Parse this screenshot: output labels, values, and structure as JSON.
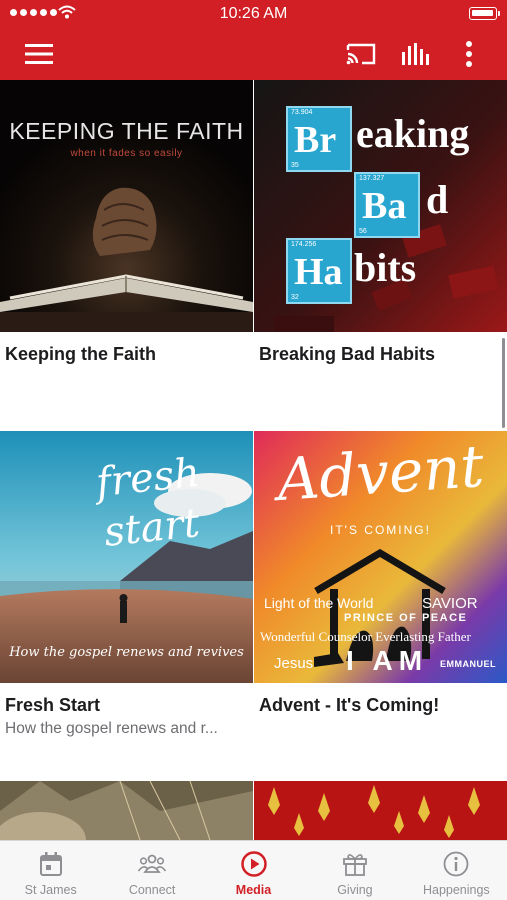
{
  "status_bar": {
    "time": "10:26 AM"
  },
  "nav": {
    "menu_icon": "hamburger-menu-icon",
    "cast_icon": "cast-icon",
    "audio_icon": "audio-bars-icon",
    "more_icon": "vertical-ellipsis-icon"
  },
  "series": [
    {
      "title": "Keeping the Faith",
      "subtitle": "",
      "art": {
        "headline": "KEEPING THE FAITH",
        "tagline": "when it fades so easily"
      }
    },
    {
      "title": "Breaking Bad Habits",
      "subtitle": "",
      "art": {
        "el1": {
          "num": "73.904",
          "sym": "Br",
          "rest": "eaking",
          "low": "35"
        },
        "el2": {
          "num": "137.327",
          "sym": "Ba",
          "rest": "d",
          "low": "56"
        },
        "el3": {
          "num": "174.256",
          "sym": "Ha",
          "rest": "bits",
          "low": "32"
        }
      }
    },
    {
      "title": "Fresh Start",
      "subtitle": "How the gospel renews and r...",
      "art": {
        "line1": "fresh",
        "line2": "start",
        "tagline": "How the gospel renews and revives"
      }
    },
    {
      "title": "Advent - It's Coming!",
      "subtitle": "",
      "art": {
        "script": "Advent",
        "tagline": "IT'S COMING!",
        "light": "Light of the World",
        "savior": "SAVIOR",
        "prince": "PRINCE OF PEACE",
        "wonderful": "Wonderful Counselor  Everlasting Father",
        "jesus": "Jesus",
        "iam": "I AM",
        "emmanuel": "EMMANUEL"
      }
    }
  ],
  "tabs": [
    {
      "label": "St James",
      "icon": "calendar-icon",
      "active": false
    },
    {
      "label": "Connect",
      "icon": "people-group-icon",
      "active": false
    },
    {
      "label": "Media",
      "icon": "play-circle-icon",
      "active": true
    },
    {
      "label": "Giving",
      "icon": "gift-icon",
      "active": false
    },
    {
      "label": "Happenings",
      "icon": "info-circle-icon",
      "active": false
    }
  ],
  "colors": {
    "brand": "#d21f26",
    "tab_inactive": "#8e8e93",
    "tabbar_bg": "#f7f7f7"
  }
}
